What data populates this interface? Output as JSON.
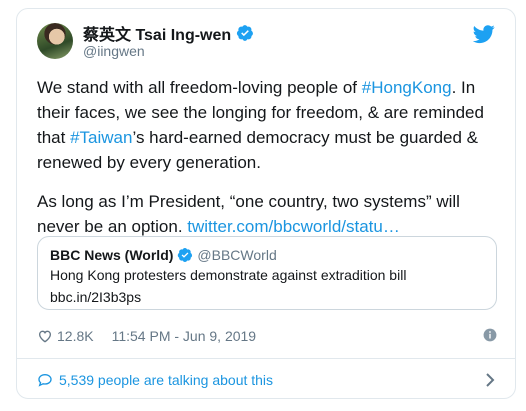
{
  "tweet": {
    "author_name": "蔡英文 Tsai Ing-wen",
    "author_handle": "@iingwen",
    "paragraph1": [
      {
        "text": "We stand with all freedom-loving people of ",
        "link": false
      },
      {
        "text": "#HongKong",
        "link": true
      },
      {
        "text": ". In their faces, we see the longing for freedom, & are reminded that ",
        "link": false
      },
      {
        "text": "#Taiwan",
        "link": true
      },
      {
        "text": "’s hard-earned democracy must be guarded & renewed by every generation.",
        "link": false
      }
    ],
    "paragraph2": [
      {
        "text": "As long as I’m President, “one country, two systems” will never be an option. ",
        "link": false
      },
      {
        "text": "twitter.com/bbcworld/statu…",
        "link": true
      }
    ],
    "quoted": {
      "author_name": "BBC News (World)",
      "author_handle": "@BBCWorld",
      "text": "Hong Kong protesters demonstrate against extradition bill",
      "link": "bbc.in/2I3b3ps"
    },
    "likes": "12.8K",
    "timestamp": "11:54 PM - Jun 9, 2019",
    "talking": "5,539 people are talking about this"
  },
  "icons": {
    "verified": "verified-badge-icon",
    "bird": "twitter-bird-icon",
    "heart": "heart-icon",
    "info": "info-icon",
    "bubble": "comment-bubble-icon",
    "chevron": "chevron-right-icon"
  },
  "colors": {
    "accent": "#1b95e0",
    "text": "#14171a",
    "secondary": "#657786",
    "border": "#e1e8ed",
    "verified": "#1da1f2"
  }
}
